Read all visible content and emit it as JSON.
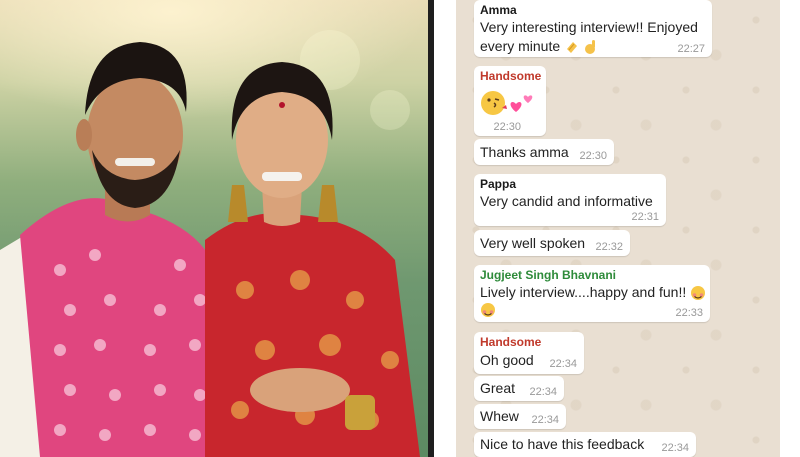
{
  "chat": {
    "messages": [
      {
        "sender": "Amma",
        "line1": "Very interesting interview!! Enjoyed",
        "line2": "every minute",
        "time": "22:27"
      },
      {
        "sender": "Handsome",
        "time": "22:30"
      },
      {
        "text": "Thanks amma",
        "time": "22:30"
      },
      {
        "sender": "Pappa",
        "text": "Very candid and informative",
        "time": "22:31"
      },
      {
        "text": "Very well spoken",
        "time": "22:32"
      },
      {
        "sender": "Jugjeet Singh Bhavnani",
        "text": "Lively interview....happy and fun!!",
        "time": "22:33"
      },
      {
        "sender": "Handsome",
        "text": "Oh good",
        "time": "22:34"
      },
      {
        "text": "Great",
        "time": "22:34"
      },
      {
        "text": "Whew",
        "time": "22:34"
      },
      {
        "text": "Nice to have this feedback",
        "time": "22:34"
      }
    ]
  },
  "colors": {
    "sender_amma": "#1a1a1a",
    "sender_handsome": "#c0392b",
    "sender_pappa": "#1a1a1a",
    "sender_jugjeet": "#2e8b3a",
    "chat_wallpaper": "#e9dfd2"
  },
  "icons": [
    "clap-emoji",
    "ok-hand-emoji",
    "kiss-emoji",
    "two-hearts-emoji",
    "blush-emoji"
  ]
}
